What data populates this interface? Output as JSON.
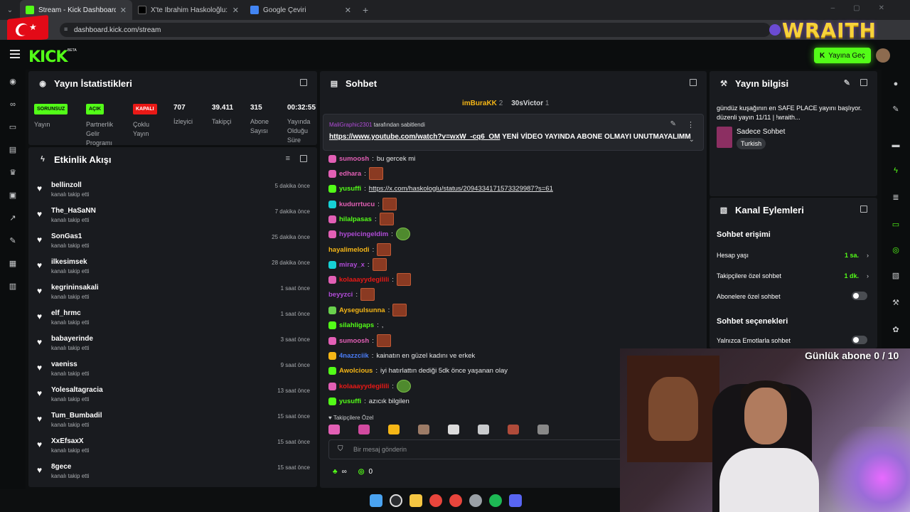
{
  "browser": {
    "tabs": [
      {
        "title": "Stream - Kick Dashboard",
        "active": true,
        "favicon_color": "#53fc18"
      },
      {
        "title": "X'te İbrahim Haskoloğlu: \"İstanb",
        "active": false,
        "favicon_color": "#000000"
      },
      {
        "title": "Google Çeviri",
        "active": false,
        "favicon_color": "#4285f4"
      }
    ],
    "url": "dashboard.kick.com/stream",
    "overlay_brand": "WRAITH"
  },
  "topbar": {
    "logo": "KICK",
    "beta": "BETA",
    "go_live_label": "Yayına Geç"
  },
  "left_sidebar_icons": [
    "stream-icon",
    "link-icon",
    "monitor-icon",
    "library-icon",
    "trophy-icon",
    "video-icon",
    "analytics-icon",
    "tools-icon",
    "community-icon",
    "toolbox-icon"
  ],
  "right_sidebar_icons": [
    "info-icon",
    "edit-icon",
    "camera-icon",
    "bolt-icon",
    "list-icon",
    "chat-icon",
    "record-icon",
    "panel-icon",
    "wrench-icon",
    "gear-icon"
  ],
  "stats": {
    "title": "Yayın İstatistikleri",
    "items": [
      {
        "badge": "SORUNSUZ",
        "badge_color": "green",
        "label": "Yayın"
      },
      {
        "badge": "AÇIK",
        "badge_color": "green",
        "label": "Partnerlik Gelir Programı"
      },
      {
        "badge": "KAPALI",
        "badge_color": "red",
        "label": "Çoklu Yayın"
      },
      {
        "value": "707",
        "label": "İzleyici"
      },
      {
        "value": "39.411",
        "label": "Takipçi"
      },
      {
        "value": "315",
        "label": "Abone Sayısı"
      },
      {
        "value": "00:32:55",
        "label": "Yayında Olduğu Süre"
      }
    ]
  },
  "activity": {
    "title": "Etkinlik Akışı",
    "items": [
      {
        "name": "bellinzoll",
        "action": "kanalı takip etti",
        "time": "5 dakika önce"
      },
      {
        "name": "The_HaSaNN",
        "action": "kanalı takip etti",
        "time": "7 dakika önce"
      },
      {
        "name": "SonGas1",
        "action": "kanalı takip etti",
        "time": "25 dakika önce"
      },
      {
        "name": "ilkesimsek",
        "action": "kanalı takip etti",
        "time": "28 dakika önce"
      },
      {
        "name": "kegrininsakali",
        "action": "kanalı takip etti",
        "time": "1 saat önce"
      },
      {
        "name": "elf_hrmc",
        "action": "kanalı takip etti",
        "time": "1 saat önce"
      },
      {
        "name": "babayerinde",
        "action": "kanalı takip etti",
        "time": "3 saat önce"
      },
      {
        "name": "vaeniss",
        "action": "kanalı takip etti",
        "time": "9 saat önce"
      },
      {
        "name": "Yolesaltagracia",
        "action": "kanalı takip etti",
        "time": "13 saat önce"
      },
      {
        "name": "Tum_Bumbadil",
        "action": "kanalı takip etti",
        "time": "15 saat önce"
      },
      {
        "name": "XxEfsaxX",
        "action": "kanalı takip etti",
        "time": "15 saat önce"
      },
      {
        "name": "8gece",
        "action": "kanalı takip etti",
        "time": "15 saat önce"
      }
    ]
  },
  "chat": {
    "title": "Sohbet",
    "top_chatters": [
      {
        "name": "imBuraKK",
        "count": "2"
      },
      {
        "name": "30sVictor",
        "count": "1"
      }
    ],
    "pinned": {
      "by_user": "MaliGraphic2301",
      "by_suffix": "tarafından sabitlendi",
      "link": "https://www.youtube.com/watch?v=wxW_-cq6_OM",
      "text": "YENİ VİDEO YAYINDA ABONE OLMAYI UNUTMAYALIMM"
    },
    "messages": [
      {
        "user": "sumoosh",
        "color": "#e25fb5",
        "badge": "#e25fb5",
        "text": "bu gercek mi"
      },
      {
        "user": "edhara",
        "color": "#e25fb5",
        "badge": "#e25fb5",
        "text": "",
        "emote": "pepe"
      },
      {
        "user": "yusuffi",
        "color": "#53fc18",
        "badge": "#53fc18",
        "text": "https://x.com/haskologlu/status/2094334171573329987?s=61",
        "link": true
      },
      {
        "user": "kudurrtucu",
        "color": "#e25fb5",
        "badge": "#16d1d6",
        "text": "",
        "emote": "pepe"
      },
      {
        "user": "hilalpasas",
        "color": "#53fc18",
        "badge": "#e25fb5",
        "text": "",
        "emote": "pepe"
      },
      {
        "user": "hypeicingeldim",
        "color": "#b04bd7",
        "badge": "#e25fb5",
        "text": "",
        "emote": "frog"
      },
      {
        "user": "hayalimelodi",
        "color": "#f5b616",
        "badge": "",
        "text": "",
        "emote": "pepe"
      },
      {
        "user": "miray_x",
        "color": "#b04bd7",
        "badge": "#16d1d6",
        "text": "",
        "emote": "pepe"
      },
      {
        "user": "kolaaayydegilili",
        "color": "#e91916",
        "badge": "#e25fb5",
        "text": "",
        "emote": "pepe"
      },
      {
        "user": "beyyzci",
        "color": "#b04bd7",
        "badge": "",
        "text": "",
        "emote": "pepe"
      },
      {
        "user": "Aysegulsunna",
        "color": "#f5b616",
        "badge": "#6ad14d",
        "text": "",
        "emote": "pepe"
      },
      {
        "user": "silahligaps",
        "color": "#53fc18",
        "badge": "#53fc18",
        "text": ","
      },
      {
        "user": "sumoosh",
        "color": "#e25fb5",
        "badge": "#e25fb5",
        "text": "",
        "emote": "pepe"
      },
      {
        "user": "4nazzciik",
        "color": "#4a7cf6",
        "badge": "#f5b616",
        "text": "kainatın en güzel kadını ve erkek"
      },
      {
        "user": "Awolcious",
        "color": "#f5b616",
        "badge": "#53fc18",
        "text": "iyi hatırlattın dediği 5dk önce yaşanan olay"
      },
      {
        "user": "kolaaayydegilili",
        "color": "#e91916",
        "badge": "#e25fb5",
        "text": "",
        "emote": "frog"
      },
      {
        "user": "yusuffi",
        "color": "#53fc18",
        "badge": "#53fc18",
        "text": "azıcık bilgilen"
      }
    ],
    "followers_only_label": "Takipçilere Özel",
    "input_placeholder": "Bir mesaj gönderin",
    "footer_infinity": "∞",
    "footer_count": "0"
  },
  "stream_info": {
    "title": "Yayın bilgisi",
    "description": "gündüz kuşağının en SAFE PLACE yayını başlıyor. düzenli yayın 11/11 | !wraith...",
    "category": "Sadece Sohbet",
    "tag": "Turkish"
  },
  "channel_actions": {
    "title": "Kanal Eylemleri",
    "section1": "Sohbet erişimi",
    "rows1": [
      {
        "label": "Hesap yaşı",
        "value": "1 sa."
      },
      {
        "label": "Takipçilere özel sohbet",
        "value": "1 dk."
      },
      {
        "label": "Abonelere özel sohbet",
        "toggle": "off"
      }
    ],
    "section2": "Sohbet seçenekleri",
    "rows2": [
      {
        "label": "Yalnızca Emotlarla sohbet",
        "toggle": "off"
      }
    ]
  },
  "overlay": {
    "daily_subs": "Günlük abone 0 / 10"
  }
}
